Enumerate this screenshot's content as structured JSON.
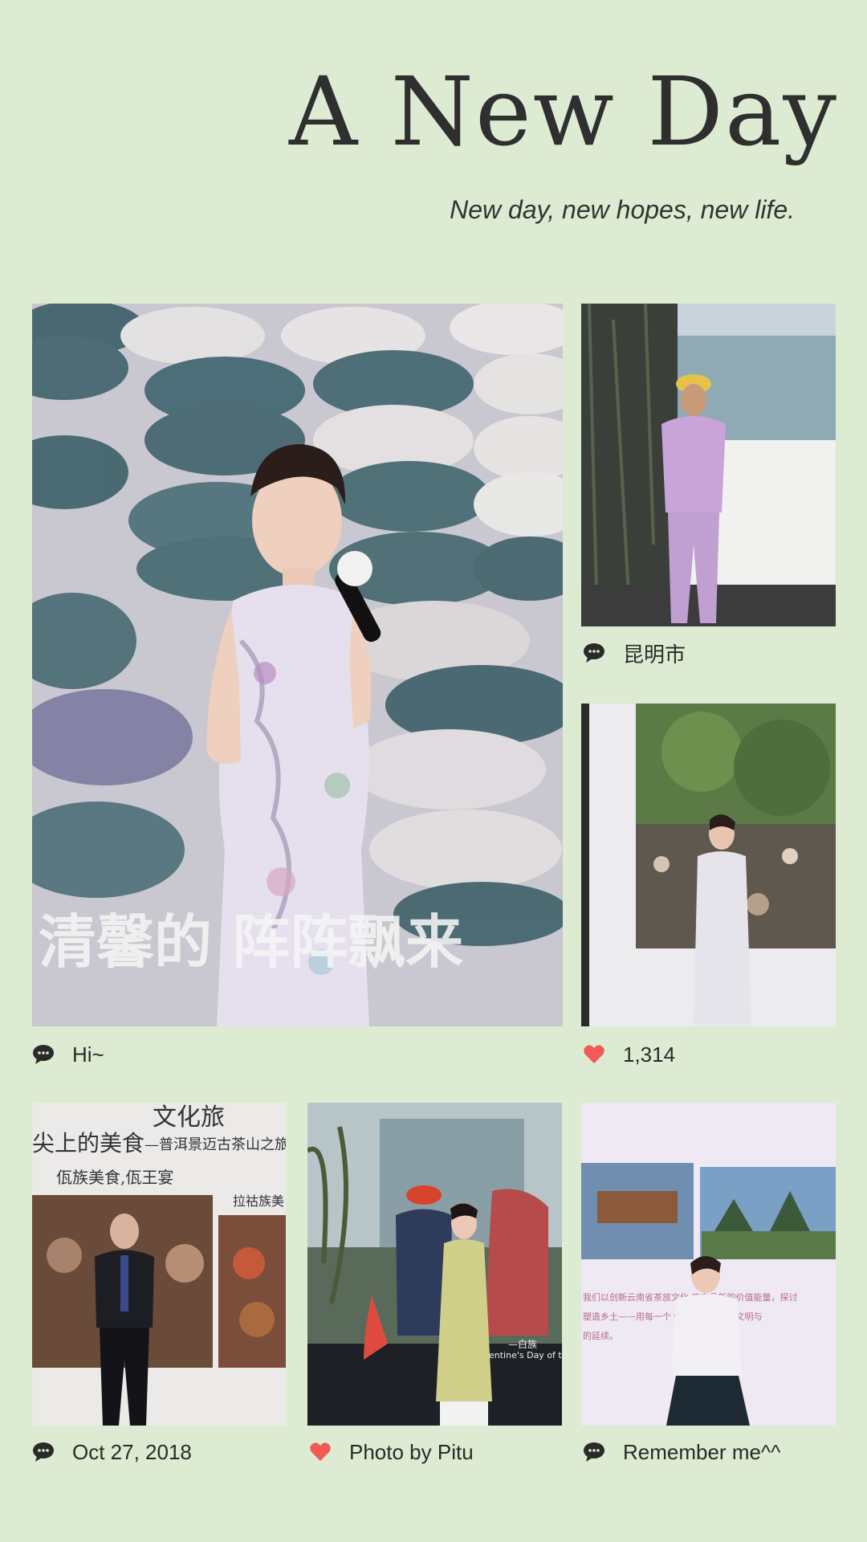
{
  "header": {
    "title": "A New Day",
    "subtitle": "New day, new hopes, new life."
  },
  "photos": {
    "main": {
      "overlay_text": "清馨的   阵阵飘来"
    },
    "p1": {
      "caption_icon": "comment-icon",
      "caption": "昆明市"
    },
    "p2": {
      "caption_icon": "heart-icon",
      "caption": "1,314"
    },
    "main_caption": {
      "caption_icon": "comment-icon",
      "caption": "Hi~"
    },
    "p3": {
      "caption_icon": "comment-icon",
      "caption": "Oct 27, 2018",
      "slide_line1": "文化旅",
      "slide_line2": "—普洱景迈古茶山之旅",
      "slide_line3": "尖上的美食",
      "slide_line4": "佤族美食,佤王宴",
      "slide_line5": "拉祜族美"
    },
    "p4": {
      "caption_icon": "heart-icon",
      "caption": "Photo by Pitu",
      "slide_text": "—白族",
      "slide_text2": "entine's Day of t"
    },
    "p5": {
      "caption_icon": "comment-icon",
      "caption": "Remember me^^",
      "slide_line1": "我们以创新云南省茶旅文化    农产品新的价值能量，探讨",
      "slide_line2": "塑造乡土——用每一个             性，表达自然、文明与",
      "slide_line3": "的延续。"
    }
  },
  "colors": {
    "background": "#dcebd1",
    "heart": "#f25a57",
    "comment": "#2a2a2a"
  }
}
